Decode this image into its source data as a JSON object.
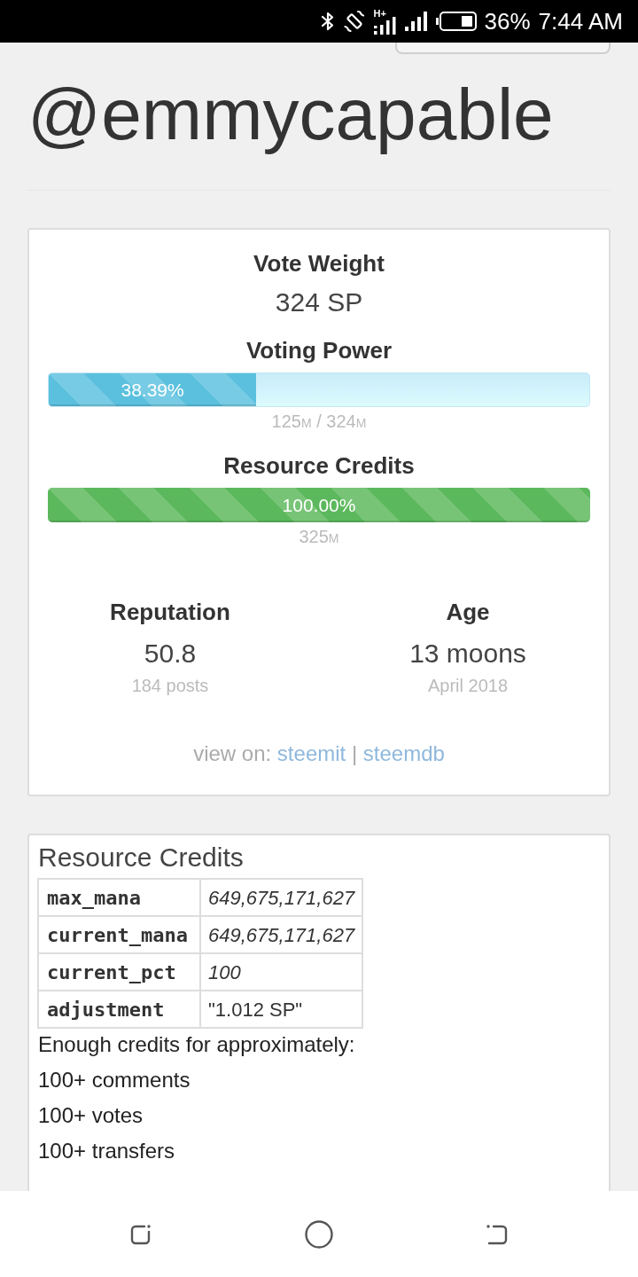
{
  "status_bar": {
    "network_type": "H+",
    "battery": "36%",
    "time": "7:44 AM"
  },
  "profile": {
    "username": "@emmycapable"
  },
  "summary_card": {
    "vote_weight": {
      "label": "Vote Weight",
      "value": "324 SP"
    },
    "meters": [
      {
        "kind": "voting",
        "label": "Voting Power",
        "level": 0.3839,
        "percent": "38.39%",
        "reading": [
          {
            "number": "125",
            "unit": "M"
          },
          {
            "number": "324",
            "unit": "M"
          }
        ],
        "separator": "/"
      },
      {
        "kind": "credits",
        "label": "Resource Credits",
        "level": 1,
        "percent": "100.00%",
        "reading": [
          {
            "number": "325",
            "unit": "M"
          }
        ]
      }
    ],
    "stats": [
      {
        "label": "Reputation",
        "value": "50.8",
        "note": "184 posts"
      },
      {
        "label": "Age",
        "value": "13 moons",
        "note": "April 2018"
      }
    ],
    "view_on": {
      "prefix": "view on:",
      "links": [
        "steemit",
        "steemdb"
      ],
      "separator": "|"
    }
  },
  "credits_card": {
    "title": "Resource Credits",
    "rows": [
      {
        "key": "max_mana",
        "value": "649,675,171,627",
        "kind": "number"
      },
      {
        "key": "current_mana",
        "value": "649,675,171,627",
        "kind": "number"
      },
      {
        "key": "current_pct",
        "value": "100",
        "kind": "number"
      },
      {
        "key": "adjustment",
        "value": "\"1.012 SP\"",
        "kind": "string"
      }
    ],
    "summary": "Enough credits for approximately:",
    "estimates": [
      "100+ comments",
      "100+ votes",
      "100+ transfers"
    ]
  }
}
